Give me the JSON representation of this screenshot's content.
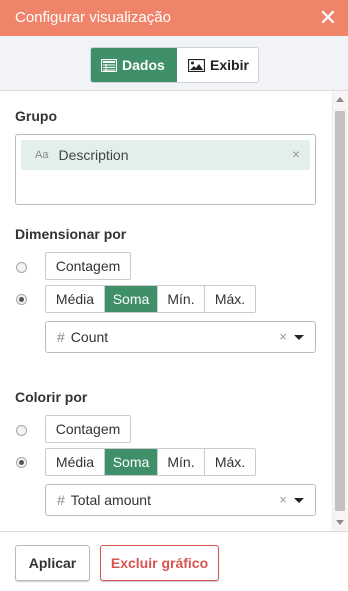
{
  "header": {
    "title": "Configurar visualização",
    "close_icon": "close-icon"
  },
  "tabs": [
    {
      "label": "Dados",
      "icon": "table-icon",
      "active": true
    },
    {
      "label": "Exibir",
      "icon": "image-icon",
      "active": false
    }
  ],
  "grupo": {
    "label": "Grupo",
    "chip": {
      "type_icon": "Aa",
      "label": "Description",
      "remove": "×"
    }
  },
  "dimensionar": {
    "label": "Dimensionar por",
    "count_option": "Contagem",
    "aggregations": [
      "Média",
      "Soma",
      "Mín.",
      "Máx."
    ],
    "selected_aggregation": "Soma",
    "field": {
      "icon": "#",
      "value": "Count",
      "clear": "×"
    }
  },
  "colorir": {
    "label": "Colorir por",
    "count_option": "Contagem",
    "aggregations": [
      "Média",
      "Soma",
      "Mín.",
      "Máx."
    ],
    "selected_aggregation": "Soma",
    "field": {
      "icon": "#",
      "value": "Total amount",
      "clear": "×"
    }
  },
  "footer": {
    "apply_label": "Aplicar",
    "delete_label": "Excluir gráfico"
  },
  "colors": {
    "header": "#f0846a",
    "accent": "#3f8f68",
    "danger": "#d9534f"
  }
}
